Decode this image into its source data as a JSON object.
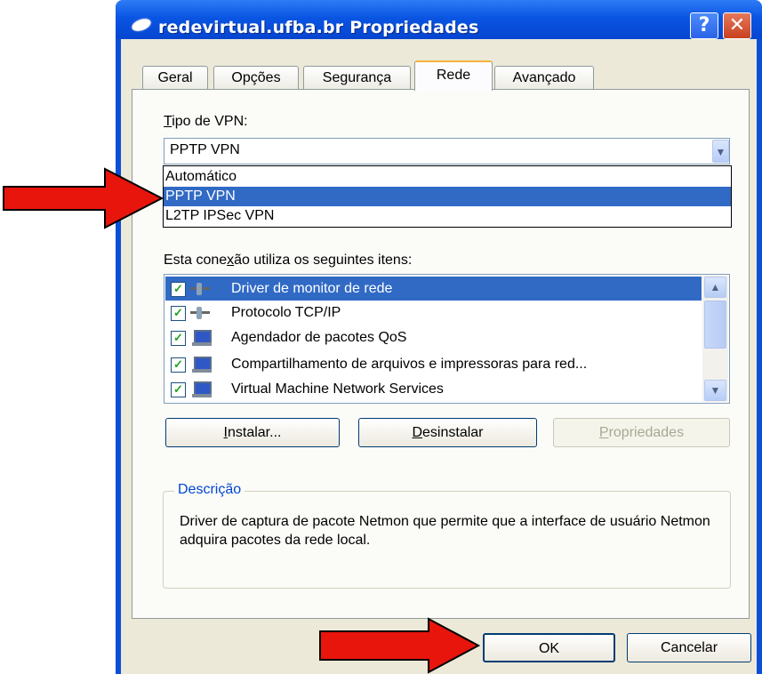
{
  "window": {
    "title": "redevirtual.ufba.br Propriedades",
    "help_label": "?",
    "close_label": "✕"
  },
  "tabs": [
    {
      "label": "Geral"
    },
    {
      "label": "Opções"
    },
    {
      "label": "Segurança"
    },
    {
      "label": "Rede",
      "active": true
    },
    {
      "label": "Avançado"
    }
  ],
  "vpn": {
    "label_accel": "T",
    "label_rest": "ipo de VPN:",
    "selected_value": "PPTP VPN",
    "options": [
      "Automático",
      "PPTP VPN",
      "L2TP IPSec VPN"
    ],
    "highlighted_index": 1
  },
  "items_section": {
    "label_pre": "Esta cone",
    "label_accel": "x",
    "label_post": "ão utiliza os seguintes itens:"
  },
  "items": [
    {
      "label": "Driver de monitor de rede",
      "checked": true,
      "icon": "network-protocol-icon",
      "selected": true
    },
    {
      "label": "Protocolo TCP/IP",
      "checked": true,
      "icon": "network-protocol-icon"
    },
    {
      "label": "Agendador de pacotes QoS",
      "checked": true,
      "icon": "computer-network-icon"
    },
    {
      "label": "Compartilhamento de arquivos e impressoras para red...",
      "checked": true,
      "icon": "computer-network-icon"
    },
    {
      "label": "Virtual Machine Network Services",
      "checked": true,
      "icon": "computer-network-icon"
    }
  ],
  "buttons": {
    "install_accel": "I",
    "install_rest": "nstalar...",
    "uninstall_accel": "D",
    "uninstall_rest": "esinstalar",
    "properties_accel": "P",
    "properties_rest": "ropriedades",
    "ok": "OK",
    "cancel": "Cancelar"
  },
  "description": {
    "title": "Descrição",
    "text": "Driver de captura de pacote Netmon que permite que a interface de usuário Netmon adquira pacotes da rede local."
  },
  "colors": {
    "selection": "#316ac5",
    "titlebar": "#0a55e3",
    "arrow": "#e8150c",
    "face": "#ece9d8"
  }
}
